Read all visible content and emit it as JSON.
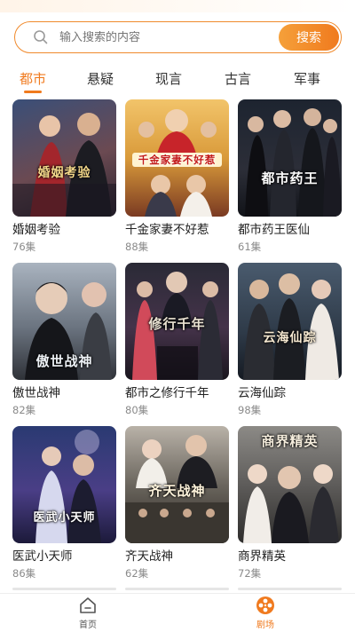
{
  "search": {
    "placeholder": "输入搜索的内容",
    "button_label": "搜索"
  },
  "tabs": [
    {
      "label": "都市",
      "active": true
    },
    {
      "label": "悬疑",
      "active": false
    },
    {
      "label": "现言",
      "active": false
    },
    {
      "label": "古言",
      "active": false
    },
    {
      "label": "军事",
      "active": false
    }
  ],
  "dramas": [
    {
      "title": "婚姻考验",
      "episodes": "76集",
      "poster_text": "婚姻考验"
    },
    {
      "title": "千金家妻不好惹",
      "episodes": "88集",
      "poster_text": "千金家妻不好惹"
    },
    {
      "title": "都市药王医仙",
      "episodes": "61集",
      "poster_text": "都市药王"
    },
    {
      "title": "傲世战神",
      "episodes": "82集",
      "poster_text": "傲世战神"
    },
    {
      "title": "都市之修行千年",
      "episodes": "80集",
      "poster_text": "修行千年"
    },
    {
      "title": "云海仙踪",
      "episodes": "98集",
      "poster_text": "云海仙踪"
    },
    {
      "title": "医武小天师",
      "episodes": "86集",
      "poster_text": "医武小天师"
    },
    {
      "title": "齐天战神",
      "episodes": "62集",
      "poster_text": "齐天战神"
    },
    {
      "title": "商界精英",
      "episodes": "72集",
      "poster_text": "商界精英"
    }
  ],
  "bottom_nav": [
    {
      "label": "首页",
      "icon": "home-icon",
      "active": false
    },
    {
      "label": "剧场",
      "icon": "film-reel-icon",
      "active": true
    }
  ],
  "colors": {
    "accent": "#f07a1e",
    "inactive": "#555555"
  }
}
